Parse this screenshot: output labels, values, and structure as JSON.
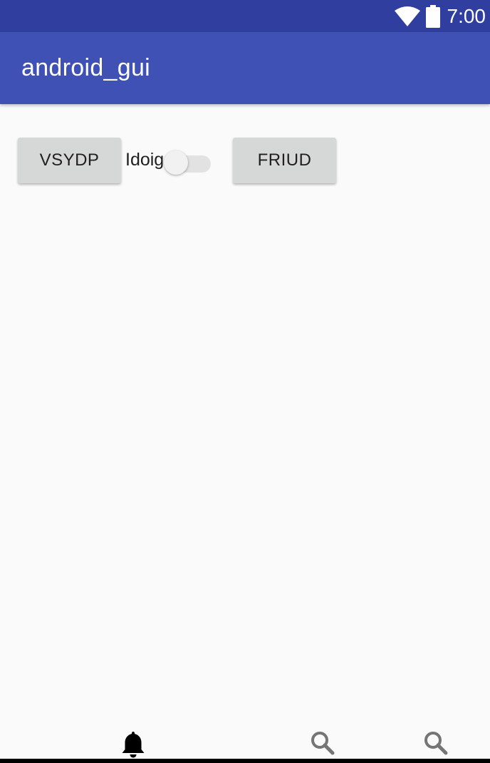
{
  "status_bar": {
    "time": "7:00",
    "icons": [
      "wifi-icon",
      "battery-icon"
    ],
    "color": "#303f9f"
  },
  "app_bar": {
    "title": "android_gui",
    "color": "#3f51b5"
  },
  "content": {
    "left_button_label": "VSYDP",
    "switch": {
      "label": "Idoig",
      "checked": false
    },
    "right_button_label": "FRIUD"
  },
  "bottom_nav": {
    "items": [
      {
        "icon": "bell-icon",
        "active": true
      },
      {
        "icon": "search-icon",
        "active": false
      },
      {
        "icon": "search-icon",
        "active": false
      }
    ]
  }
}
